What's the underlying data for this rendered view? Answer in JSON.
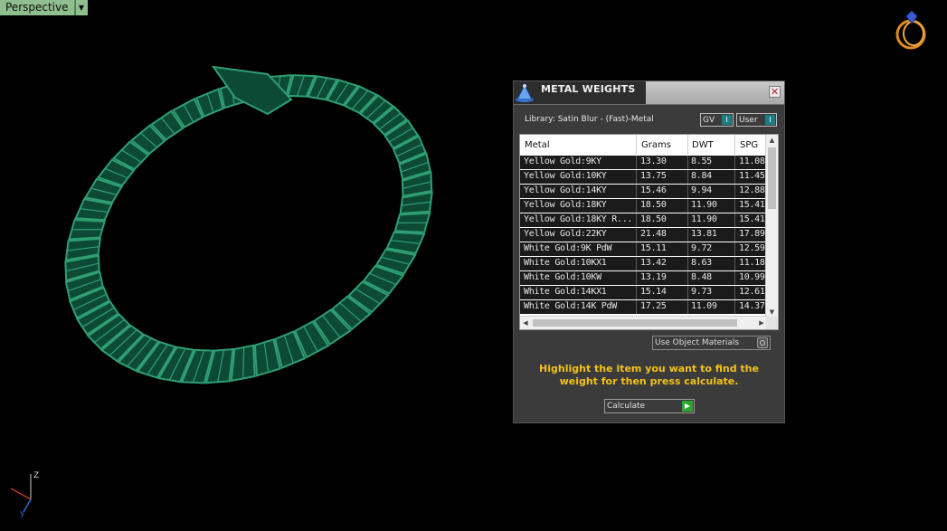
{
  "viewport": {
    "label": "Perspective",
    "dropdown_icon": "triangle-down"
  },
  "scene": {
    "object": "snake-bracelet",
    "wire_color": "#2f9e74",
    "fill_color": "#0c4a36"
  },
  "axes": {
    "z": "Z",
    "y": "y"
  },
  "panel": {
    "title": "METAL WEIGHTS",
    "library": "Library: Satin Blur - (Fast)-Metal",
    "toggles": [
      {
        "label": "GV",
        "knob": "I"
      },
      {
        "label": "User",
        "knob": "I"
      }
    ],
    "table": {
      "columns": [
        "Metal",
        "Grams",
        "DWT",
        "SPG"
      ],
      "rows": [
        [
          "Yellow Gold:9KY",
          "13.30",
          "8.55",
          "11.08"
        ],
        [
          "Yellow Gold:10KY",
          "13.75",
          "8.84",
          "11.45"
        ],
        [
          "Yellow Gold:14KY",
          "15.46",
          "9.94",
          "12.88"
        ],
        [
          "Yellow Gold:18KY",
          "18.50",
          "11.90",
          "15.41"
        ],
        [
          "Yellow Gold:18KY R...",
          "18.50",
          "11.90",
          "15.41"
        ],
        [
          "Yellow Gold:22KY",
          "21.48",
          "13.81",
          "17.89"
        ],
        [
          "White Gold:9K PdW",
          "15.11",
          "9.72",
          "12.59"
        ],
        [
          "White Gold:10KX1",
          "13.42",
          "8.63",
          "11.18"
        ],
        [
          "White Gold:10KW",
          "13.19",
          "8.48",
          "10.99"
        ],
        [
          "White Gold:14KX1",
          "15.14",
          "9.73",
          "12.61"
        ],
        [
          "White Gold:14K PdW",
          "17.25",
          "11.09",
          "14.37"
        ]
      ]
    },
    "use_object_materials": "Use Object Materials",
    "instruction": "Highlight the item you want to find the weight for then press calculate.",
    "calculate_label": "Calculate",
    "accent_color": "#f2c21a"
  }
}
